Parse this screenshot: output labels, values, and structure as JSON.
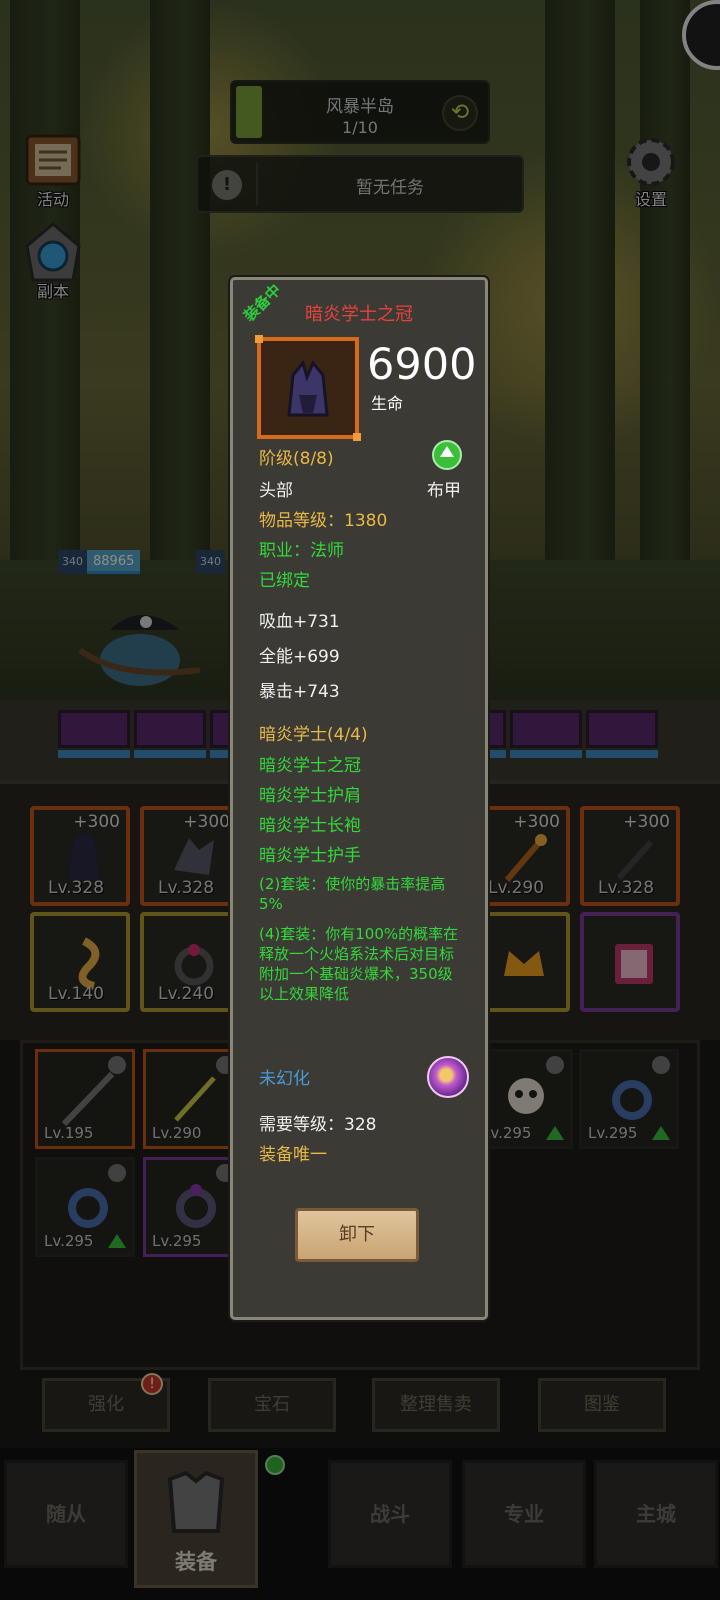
{
  "hud": {
    "zone_name": "风暴半岛",
    "zone_progress": "1/10",
    "zone_progress_fraction": 0.1,
    "task_text": "暂无任务",
    "activity_label": "活动",
    "dungeon_label": "副本",
    "settings_label": "设置",
    "ally_level": "340",
    "ally_hp": "88965",
    "enemy_level": "340"
  },
  "equipment_slots": [
    {
      "plus": "+300",
      "level": "Lv.328",
      "rarity": "orange"
    },
    {
      "plus": "+300",
      "level": "Lv.328",
      "rarity": "orange"
    },
    {
      "plus": "+300",
      "level": "Lv.290",
      "rarity": "orange"
    },
    {
      "plus": "+300",
      "level": "Lv.328",
      "rarity": "orange"
    },
    {
      "plus": "",
      "level": "Lv.140",
      "rarity": "gold"
    },
    {
      "plus": "",
      "level": "Lv.240",
      "rarity": "gold"
    },
    {
      "plus": "",
      "level": "",
      "rarity": "gold"
    },
    {
      "plus": "",
      "level": "",
      "rarity": "purple"
    }
  ],
  "bag_items": [
    {
      "level": "Lv.195",
      "rarity": "orange",
      "locked": true,
      "upgrade": false
    },
    {
      "level": "Lv.290",
      "rarity": "orange",
      "locked": true,
      "upgrade": false
    },
    {
      "level": "Lv.295",
      "rarity": "none",
      "locked": true,
      "upgrade": true
    },
    {
      "level": "Lv.295",
      "rarity": "none",
      "locked": true,
      "upgrade": true
    },
    {
      "level": "Lv.295",
      "rarity": "none",
      "locked": true,
      "upgrade": true
    },
    {
      "level": "Lv.295",
      "rarity": "purple",
      "locked": true,
      "upgrade": false
    }
  ],
  "actions": {
    "enhance": "强化",
    "gem": "宝石",
    "sort_sell": "整理售卖",
    "codex": "图鉴",
    "enhance_badge": "!"
  },
  "nav": {
    "follower": "随从",
    "equipment": "装备",
    "battle": "战斗",
    "profession": "专业",
    "main_city": "主城"
  },
  "tooltip": {
    "equipped_tag": "装备中",
    "item_name": "暗炎学士之冠",
    "main_stat_value": "6900",
    "main_stat_label": "生命",
    "tier": "阶级(8/8)",
    "slot": "头部",
    "armor_type": "布甲",
    "item_level": "物品等级：1380",
    "class_req": "职业：法师",
    "bound": "已绑定",
    "stats": [
      "吸血+731",
      "全能+699",
      "暴击+743"
    ],
    "set_name": "暗炎学士(4/4)",
    "set_pieces": [
      "暗炎学士之冠",
      "暗炎学士护肩",
      "暗炎学士长袍",
      "暗炎学士护手"
    ],
    "set_bonus_2": "(2)套装：使你的暴击率提高5%",
    "set_bonus_4": "(4)套装：你有100%的概率在释放一个火焰系法术后对目标附加一个基础炎爆术，350级以上效果降低",
    "transmog": "未幻化",
    "required_level": "需要等级：328",
    "unique": "装备唯一",
    "unequip_button": "卸下"
  },
  "colors": {
    "item_name": "#e8423a",
    "gold_text": "#e9b845",
    "green_text": "#34d83a",
    "blue_text": "#4a9ad6",
    "orange_rarity": "#c4561b",
    "purple_rarity": "#7b3c9e"
  }
}
